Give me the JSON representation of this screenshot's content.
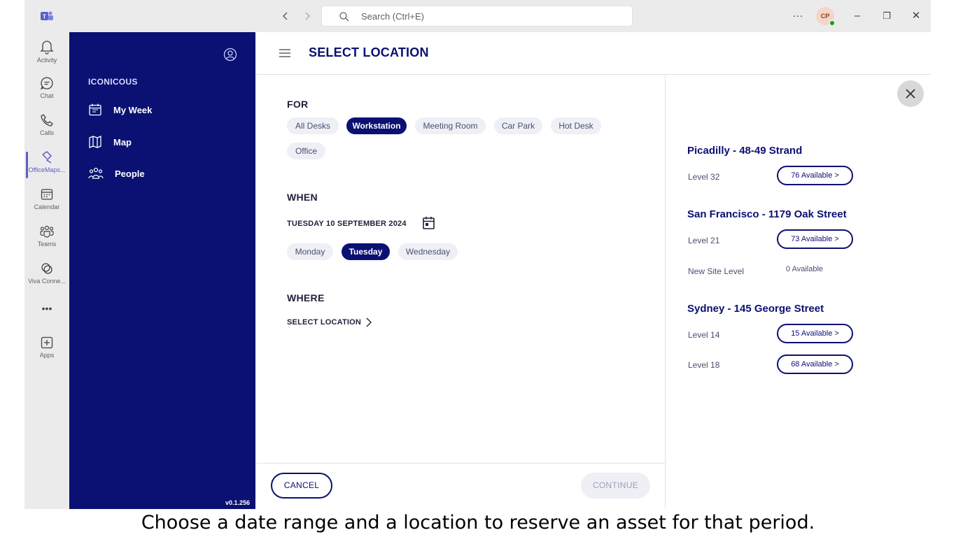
{
  "titlebar": {
    "search_placeholder": "Search (Ctrl+E)",
    "back_icon": "chevron-left-icon",
    "forward_icon": "chevron-right-icon",
    "more_label": "···",
    "avatar_initials": "CP",
    "minimize_label": "–",
    "restore_label": "❐",
    "close_label": "✕"
  },
  "rail": {
    "items": [
      {
        "label": "Activity",
        "icon": "bell-icon"
      },
      {
        "label": "Chat",
        "icon": "chat-icon"
      },
      {
        "label": "Calls",
        "icon": "phone-icon"
      },
      {
        "label": "OfficeMaps...",
        "icon": "officemaps-icon",
        "active": true
      },
      {
        "label": "Calendar",
        "icon": "calendar-icon"
      },
      {
        "label": "Teams",
        "icon": "teams-icon"
      },
      {
        "label": "Viva Conne...",
        "icon": "viva-icon"
      },
      {
        "label": "•••",
        "icon": "more-icon"
      },
      {
        "label": "Apps",
        "icon": "add-app-icon"
      }
    ]
  },
  "appnav": {
    "org": "ICONICOUS",
    "items": [
      {
        "label": "My Week",
        "icon": "calendar-week-icon"
      },
      {
        "label": "Map",
        "icon": "map-icon"
      },
      {
        "label": "People",
        "icon": "people-icon"
      }
    ],
    "version": "v0.1.256"
  },
  "header": {
    "title": "SELECT LOCATION"
  },
  "form": {
    "for_label": "FOR",
    "asset_types": [
      {
        "label": "All Desks",
        "selected": false
      },
      {
        "label": "Workstation",
        "selected": true
      },
      {
        "label": "Meeting Room",
        "selected": false
      },
      {
        "label": "Car Park",
        "selected": false
      },
      {
        "label": "Hot Desk",
        "selected": false
      },
      {
        "label": "Office",
        "selected": false
      }
    ],
    "when_label": "WHEN",
    "date": "TUESDAY 10 SEPTEMBER 2024",
    "days": [
      {
        "label": "Monday",
        "selected": false
      },
      {
        "label": "Tuesday",
        "selected": true
      },
      {
        "label": "Wednesday",
        "selected": false
      }
    ],
    "where_label": "WHERE",
    "select_location": "SELECT LOCATION",
    "cancel": "CANCEL",
    "continue": "CONTINUE"
  },
  "locations": [
    {
      "name": "Picadilly - 48-49 Strand",
      "levels": [
        {
          "level": "Level 32",
          "available": "76 Available >"
        }
      ]
    },
    {
      "name": "San Francisco - 1179 Oak Street",
      "levels": [
        {
          "level": "Level 21",
          "available": "73 Available >"
        },
        {
          "level": "New Site Level",
          "available": "0 Available"
        }
      ]
    },
    {
      "name": "Sydney - 145 George Street",
      "levels": [
        {
          "level": "Level 14",
          "available": "15 Available >"
        },
        {
          "level": "Level 18",
          "available": "68 Available >"
        }
      ]
    }
  ],
  "caption": "Choose a date range and a location to reserve an asset for that period.",
  "colors": {
    "brand_navy": "#0a1172",
    "chip_bg": "#eef0f6",
    "rail_accent": "#5b5fc7",
    "presence_green": "#13a10e"
  }
}
